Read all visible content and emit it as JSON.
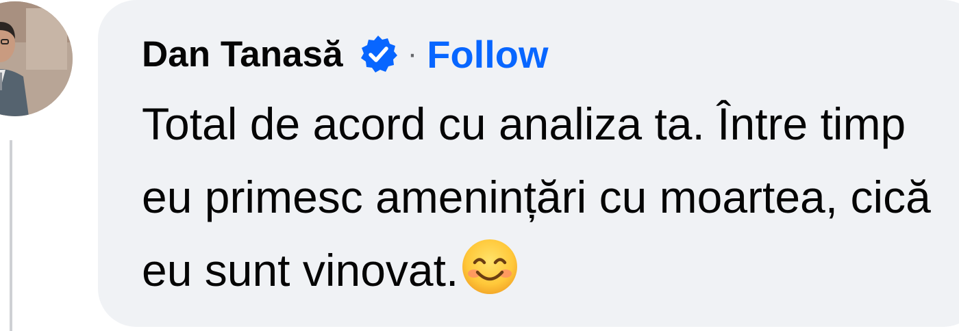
{
  "comment": {
    "author": "Dan Tanasă",
    "separator": "·",
    "follow_label": "Follow",
    "text": "Total de acord cu analiza ta. Între timp eu primesc amenințări cu moartea, cică eu sunt vinovat.",
    "emoji": "smiling-face-with-smiling-eyes-emoji"
  },
  "colors": {
    "bubble_bg": "#f0f2f5",
    "author_text": "#050505",
    "follow_link": "#0866ff",
    "verified_badge": "#0866ff",
    "thread_line": "#ced0d4"
  }
}
